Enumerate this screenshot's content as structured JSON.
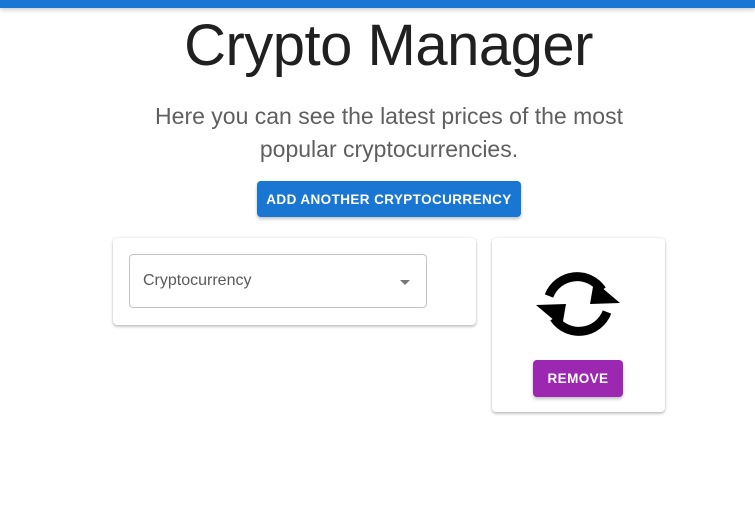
{
  "header": {
    "title": "Crypto Manager",
    "subtitle": "Here you can see the latest prices of the most popular cryptocurrencies."
  },
  "actions": {
    "add_label": "ADD ANOTHER CRYPTOCURRENCY"
  },
  "crypto_card": {
    "select_label": "Cryptocurrency",
    "icon": "refresh-icon",
    "remove_label": "REMOVE"
  },
  "colors": {
    "primary": "#1976d2",
    "secondary": "#9c27b0"
  }
}
